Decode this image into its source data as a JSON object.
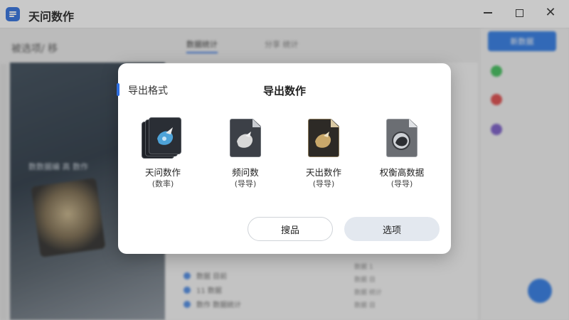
{
  "app": {
    "title": "天问数作"
  },
  "window_controls": {
    "minimize_icon": "minimize-icon",
    "maximize_icon": "maximize-icon",
    "close_glyph": "✕"
  },
  "background": {
    "toolbar_label": "被选项/ 移",
    "preview_text": "数数据编 高 数作",
    "tabs": [
      "数据统计",
      "分享 统计"
    ],
    "primary_button": "新数据",
    "list_rows": [
      "数据 目前",
      "11 数据",
      "数作 数据统计"
    ],
    "mini_rows": [
      "数据 1",
      "数据 目",
      "数据 统计",
      "数据 目"
    ]
  },
  "dialog": {
    "label": "导出格式",
    "title": "导出数作",
    "formats": [
      {
        "name": "天问数作",
        "sub": "(数率)",
        "icon": "stacked-layers-icon"
      },
      {
        "name": "频问数",
        "sub": "(导导)",
        "icon": "document-icon"
      },
      {
        "name": "天出数作",
        "sub": "(导导)",
        "icon": "image-document-icon"
      },
      {
        "name": "权衡高数据",
        "sub": "(导导)",
        "icon": "archive-document-icon"
      }
    ],
    "cancel_label": "搜品",
    "ok_label": "选项"
  }
}
